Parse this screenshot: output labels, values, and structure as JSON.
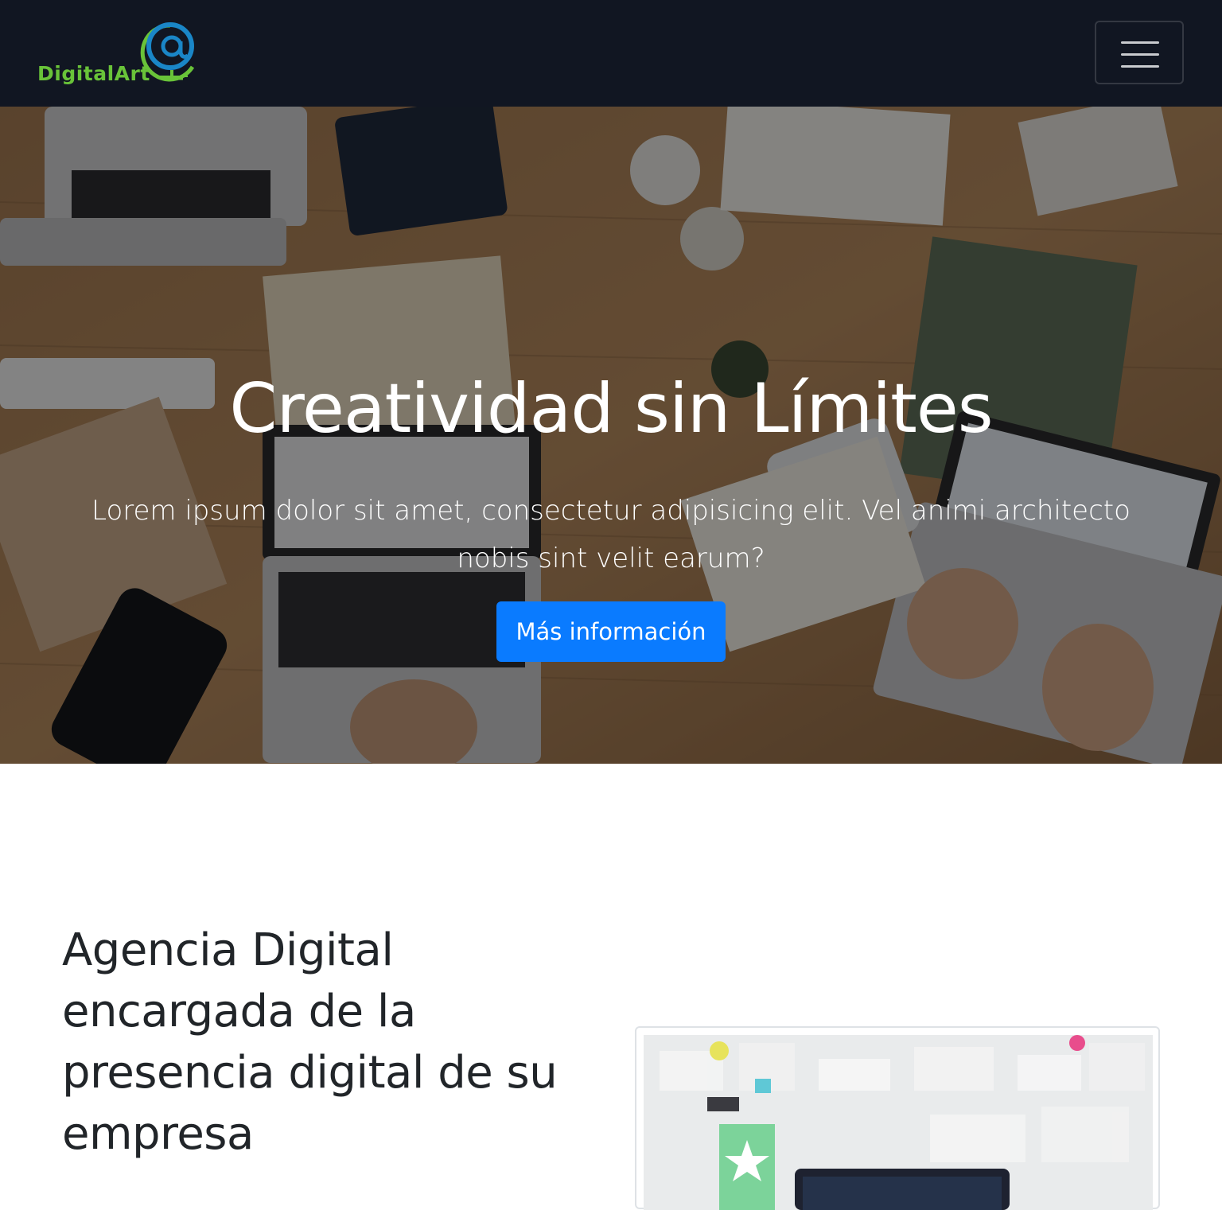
{
  "navbar": {
    "brand_text": "DigitalArt",
    "brand_icon": "at-sign-globe-logo",
    "toggler_icon": "hamburger-menu-icon",
    "colors": {
      "background": "#111622",
      "brand_green": "#69c339",
      "brand_blue": "#1a86c7"
    }
  },
  "hero": {
    "title": "Creatividad sin Límites",
    "subtitle": "Lorem ipsum dolor sit amet, consectetur adipisicing elit. Vel animi architecto nobis sint velit earum?",
    "button_label": "Más información",
    "colors": {
      "button": "#0a7bff",
      "text": "#ffffff"
    }
  },
  "about": {
    "title": "Agencia Digital encargada de la presencia digital de su empresa"
  }
}
